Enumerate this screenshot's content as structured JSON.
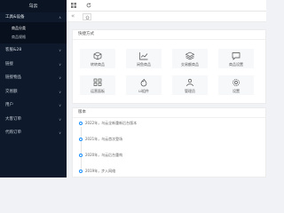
{
  "sidebar": {
    "brand": "乌云",
    "group_title": "工具&设备",
    "submenu": [
      {
        "label": "商品分类",
        "active": true
      },
      {
        "label": "商品规格",
        "active": false
      }
    ],
    "items": [
      {
        "label": "客服&28"
      },
      {
        "label": "链接"
      },
      {
        "label": "链接物品"
      },
      {
        "label": "交易额"
      },
      {
        "label": "用户"
      },
      {
        "label": "大客订单"
      },
      {
        "label": "代购订单"
      }
    ]
  },
  "topbar": {
    "menu_icon": "grid-icon",
    "refresh_icon": "refresh-icon"
  },
  "tabs": {
    "collapse_icon": "double-chevron-left-icon",
    "home_icon": "home-icon"
  },
  "shortcuts": {
    "title": "快捷方式",
    "tiles": [
      {
        "label": "转转商品",
        "icon": "cube-icon"
      },
      {
        "label": "闲鱼商品",
        "icon": "chart-icon"
      },
      {
        "label": "交易额商品",
        "icon": "layers-icon"
      },
      {
        "label": "商品设置",
        "icon": "comment-icon"
      },
      {
        "label": "运营面板",
        "icon": "apps-icon"
      },
      {
        "label": "ui组件",
        "icon": "fire-icon"
      },
      {
        "label": "管理员",
        "icon": "user-icon"
      },
      {
        "label": "设置",
        "icon": "gear-icon"
      }
    ]
  },
  "timeline": {
    "title": "版本",
    "items": [
      {
        "text": "2022年，乌云全新重新后台版本"
      },
      {
        "text": "2021年，乌云首次登场"
      },
      {
        "text": "2020年，乌云后台重构"
      },
      {
        "text": "2019年，步入网络"
      }
    ]
  },
  "colors": {
    "sidebar_bg": "#0e1a2b",
    "accent": "#1890ff",
    "content_bg": "#f0f2f5"
  }
}
